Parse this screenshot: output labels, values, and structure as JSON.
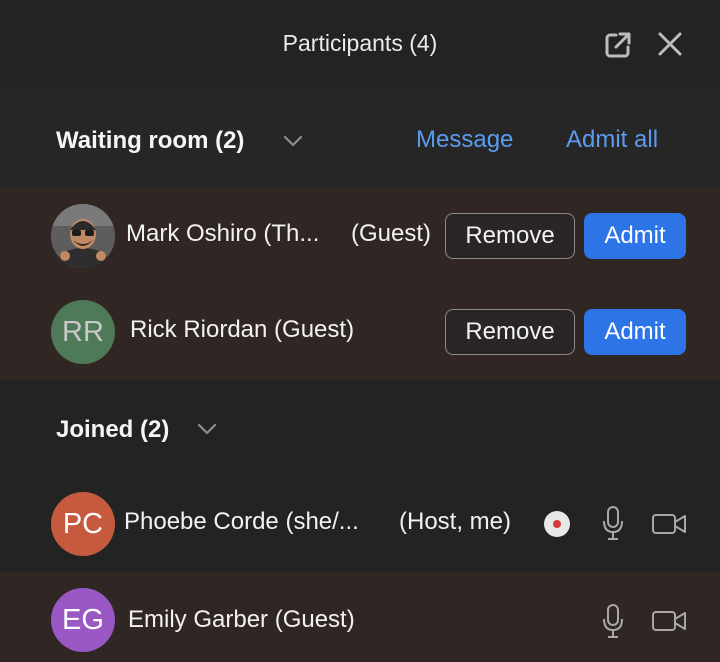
{
  "header": {
    "title": "Participants (4)"
  },
  "waiting_room": {
    "title": "Waiting room (2)",
    "message_label": "Message",
    "admit_all_label": "Admit all",
    "participants": [
      {
        "name": "Mark Oshiro (Th...",
        "role": "(Guest)",
        "remove_label": "Remove",
        "admit_label": "Admit",
        "avatar_type": "photo"
      },
      {
        "name": "Rick Riordan (Guest)",
        "initials": "RR",
        "avatar_color": "#4f7a57",
        "remove_label": "Remove",
        "admit_label": "Admit"
      }
    ]
  },
  "joined": {
    "title": "Joined (2)",
    "participants": [
      {
        "name": "Phoebe Corde (she/...",
        "role": "(Host, me)",
        "initials": "PC",
        "avatar_color": "#c55a3f",
        "recording": true,
        "icons": [
          "mic-icon",
          "video-camera-icon"
        ]
      },
      {
        "name": "Emily Garber (Guest)",
        "initials": "EG",
        "avatar_color": "#9a58c4",
        "icons": [
          "mic-icon",
          "video-camera-icon"
        ]
      }
    ]
  },
  "colors": {
    "accent": "#2d74e6",
    "link": "#5b9cf0",
    "waiting_bg": "#302725"
  }
}
